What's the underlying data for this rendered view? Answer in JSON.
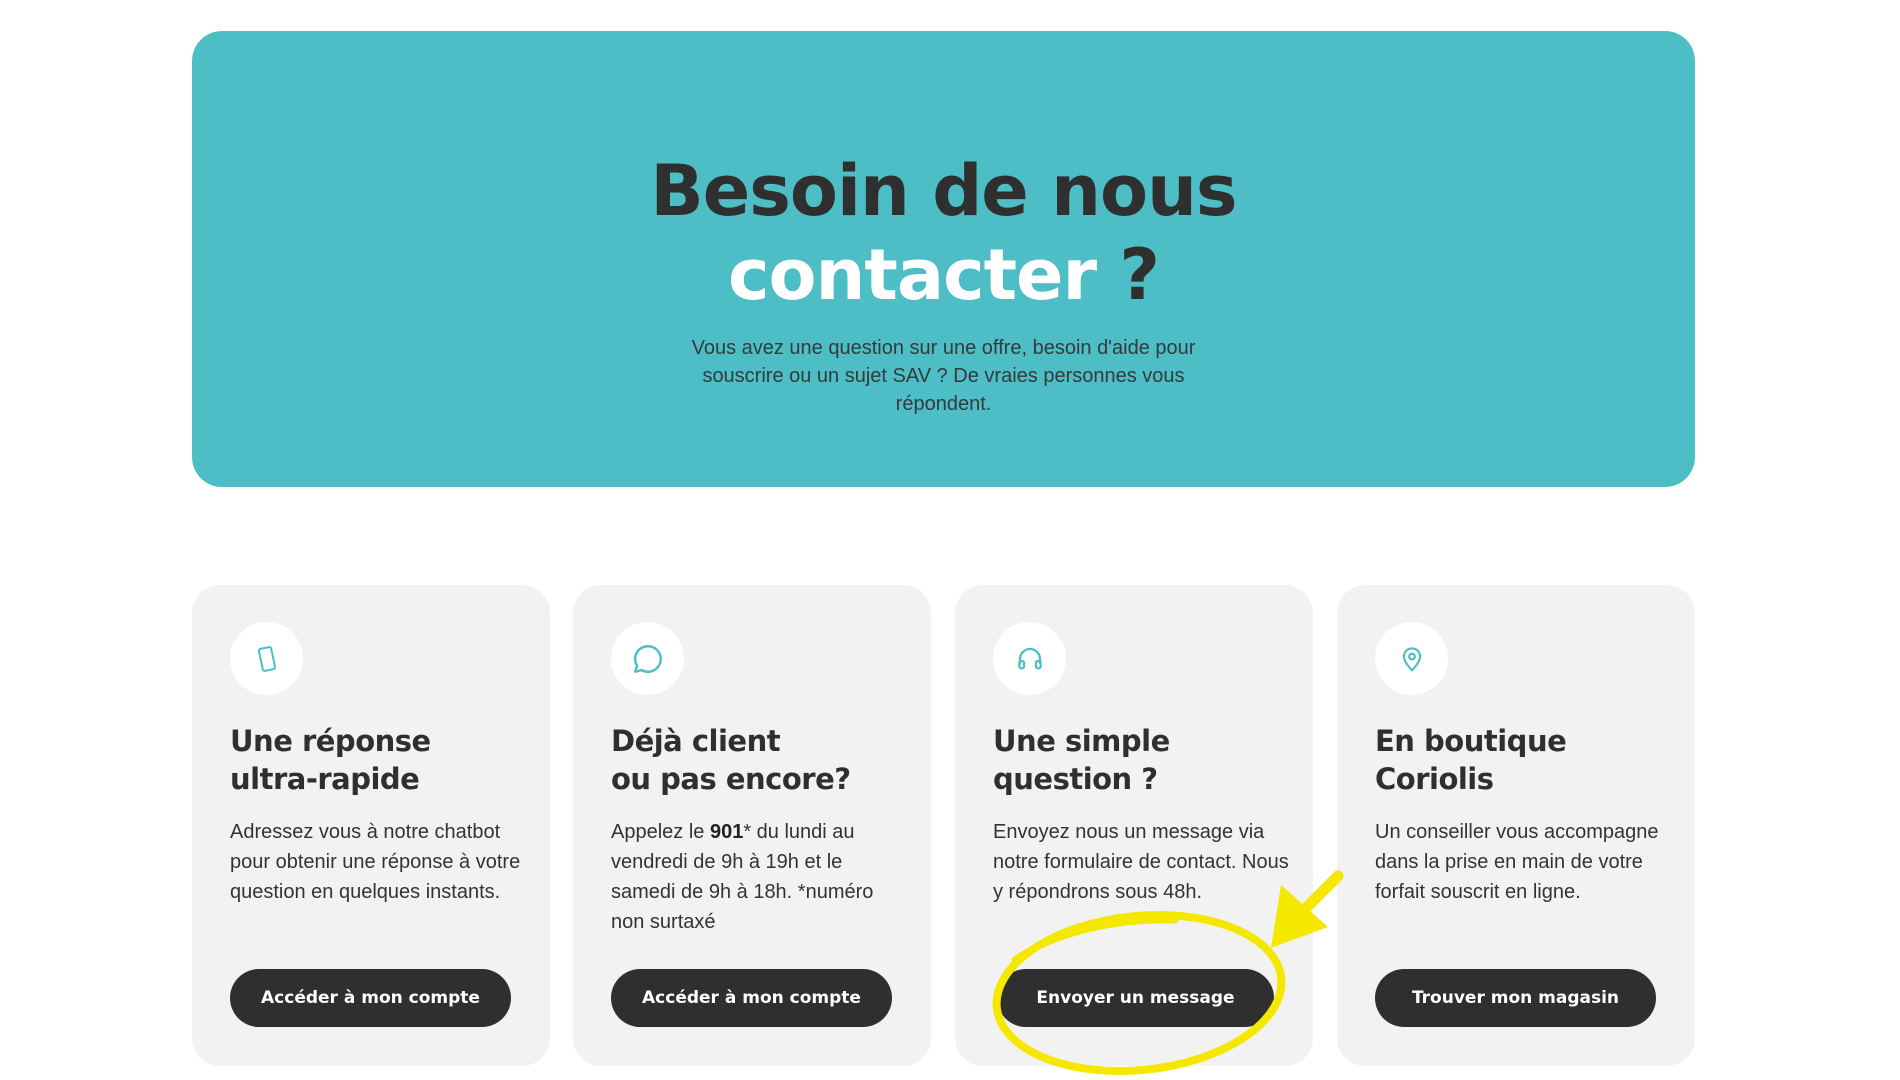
{
  "hero": {
    "title_line1": "Besoin de nous",
    "title_line2_highlight": "contacter",
    "title_line2_end": " ?",
    "subtitle": "Vous avez une question sur une offre, besoin d'aide pour souscrire ou un sujet SAV ? De vraies personnes vous répondent.",
    "background_color": "#4dbdc6"
  },
  "cards": [
    {
      "icon": "smartphone-icon",
      "title_line1": "Une réponse",
      "title_line2": "ultra-rapide",
      "text": "Adressez vous à notre chatbot pour obtenir une réponse à votre question en quelques instants.",
      "button": "Accéder à mon compte"
    },
    {
      "icon": "chat-bubble-icon",
      "title_line1": "Déjà client",
      "title_line2": "ou pas encore?",
      "text_before": "Appelez le ",
      "text_bold": "901",
      "text_after": "* du lundi au vendredi de 9h à 19h et le samedi de 9h à 18h. *numéro non surtaxé",
      "button": "Accéder à mon compte"
    },
    {
      "icon": "headset-icon",
      "title_line1": "Une simple",
      "title_line2": "question ?",
      "text": "Envoyez nous un message via notre formulaire de contact. Nous y répondrons sous 48h.",
      "button": "Envoyer un message"
    },
    {
      "icon": "location-pin-icon",
      "title_line1": "En boutique",
      "title_line2": "Coriolis",
      "text": "Un conseiller vous accompagne dans la prise en main de votre forfait souscrit en ligne.",
      "button": "Trouver mon magasin"
    }
  ],
  "annotation": {
    "color": "#f5e800",
    "shape": "ellipse-highlight-with-arrow"
  }
}
